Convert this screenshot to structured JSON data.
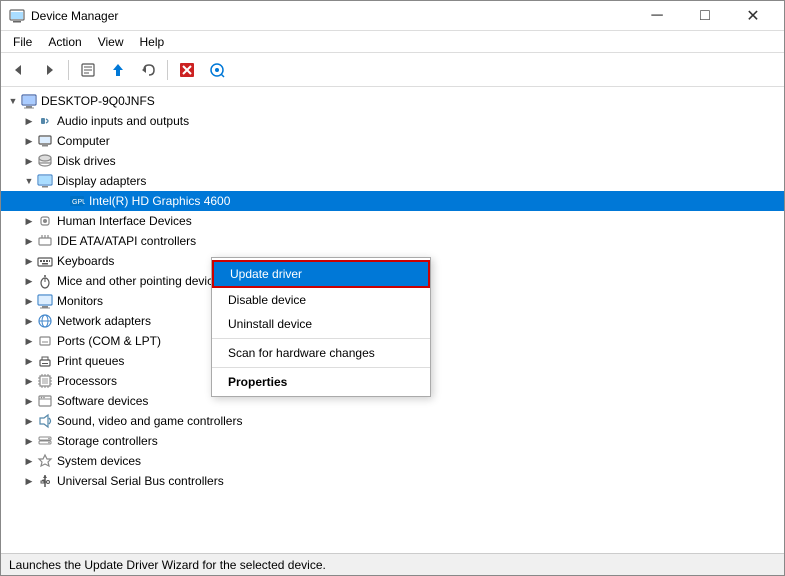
{
  "window": {
    "title": "Device Manager",
    "icon": "device-manager-icon"
  },
  "titlebar": {
    "minimize_label": "─",
    "maximize_label": "□",
    "close_label": "✕"
  },
  "menubar": {
    "items": [
      {
        "id": "file",
        "label": "File"
      },
      {
        "id": "action",
        "label": "Action"
      },
      {
        "id": "view",
        "label": "View"
      },
      {
        "id": "help",
        "label": "Help"
      }
    ]
  },
  "toolbar": {
    "buttons": [
      {
        "id": "back",
        "icon": "◀",
        "label": "Back"
      },
      {
        "id": "forward",
        "icon": "▶",
        "label": "Forward"
      },
      {
        "id": "properties",
        "icon": "📋",
        "label": "Properties"
      },
      {
        "id": "update",
        "icon": "⬆",
        "label": "Update driver"
      },
      {
        "id": "rollback",
        "icon": "↩",
        "label": "Roll Back"
      },
      {
        "id": "uninstall",
        "icon": "✖",
        "label": "Uninstall"
      },
      {
        "id": "scan",
        "icon": "🔍",
        "label": "Scan for hardware changes"
      }
    ]
  },
  "tree": {
    "root": {
      "label": "DESKTOP-9Q0JNFS",
      "expanded": true
    },
    "items": [
      {
        "id": "audio",
        "label": "Audio inputs and outputs",
        "indent": 1,
        "expanded": false,
        "icon": "audio-icon"
      },
      {
        "id": "computer",
        "label": "Computer",
        "indent": 1,
        "expanded": false,
        "icon": "computer-icon"
      },
      {
        "id": "disk",
        "label": "Disk drives",
        "indent": 1,
        "expanded": false,
        "icon": "disk-icon"
      },
      {
        "id": "display",
        "label": "Display adapters",
        "indent": 1,
        "expanded": true,
        "icon": "display-icon"
      },
      {
        "id": "intel",
        "label": "Intel(R) HD Graphics 4600",
        "indent": 2,
        "expanded": false,
        "icon": "intel-icon",
        "selected": true
      },
      {
        "id": "hid",
        "label": "Human Interface Devices",
        "indent": 1,
        "expanded": false,
        "icon": "hid-icon"
      },
      {
        "id": "ide",
        "label": "IDE ATA/ATAPI controllers",
        "indent": 1,
        "expanded": false,
        "icon": "ide-icon"
      },
      {
        "id": "keyboards",
        "label": "Keyboards",
        "indent": 1,
        "expanded": false,
        "icon": "keyboard-icon"
      },
      {
        "id": "mice",
        "label": "Mice and other pointing devices",
        "indent": 1,
        "expanded": false,
        "icon": "mouse-icon"
      },
      {
        "id": "monitors",
        "label": "Monitors",
        "indent": 1,
        "expanded": false,
        "icon": "monitor-icon"
      },
      {
        "id": "network",
        "label": "Network adapters",
        "indent": 1,
        "expanded": false,
        "icon": "network-icon"
      },
      {
        "id": "ports",
        "label": "Ports (COM & LPT)",
        "indent": 1,
        "expanded": false,
        "icon": "port-icon"
      },
      {
        "id": "print",
        "label": "Print queues",
        "indent": 1,
        "expanded": false,
        "icon": "print-icon"
      },
      {
        "id": "processors",
        "label": "Processors",
        "indent": 1,
        "expanded": false,
        "icon": "processor-icon"
      },
      {
        "id": "software",
        "label": "Software devices",
        "indent": 1,
        "expanded": false,
        "icon": "software-icon"
      },
      {
        "id": "sound",
        "label": "Sound, video and game controllers",
        "indent": 1,
        "expanded": false,
        "icon": "sound-icon"
      },
      {
        "id": "storage",
        "label": "Storage controllers",
        "indent": 1,
        "expanded": false,
        "icon": "storage-icon"
      },
      {
        "id": "system",
        "label": "System devices",
        "indent": 1,
        "expanded": false,
        "icon": "system-icon"
      },
      {
        "id": "usb",
        "label": "Universal Serial Bus controllers",
        "indent": 1,
        "expanded": false,
        "icon": "usb-icon"
      }
    ]
  },
  "context_menu": {
    "items": [
      {
        "id": "update",
        "label": "Update driver",
        "active": true,
        "bold": false
      },
      {
        "id": "disable",
        "label": "Disable device",
        "active": false,
        "bold": false
      },
      {
        "id": "uninstall",
        "label": "Uninstall device",
        "active": false,
        "bold": false
      },
      {
        "id": "sep1",
        "type": "separator"
      },
      {
        "id": "scan",
        "label": "Scan for hardware changes",
        "active": false,
        "bold": false
      },
      {
        "id": "sep2",
        "type": "separator"
      },
      {
        "id": "properties",
        "label": "Properties",
        "active": false,
        "bold": true
      }
    ]
  },
  "status_bar": {
    "text": "Launches the Update Driver Wizard for the selected device."
  }
}
